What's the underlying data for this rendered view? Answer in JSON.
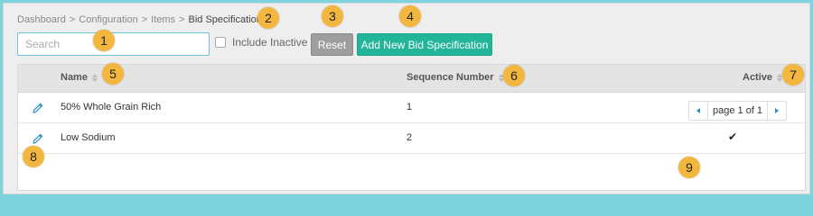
{
  "breadcrumb": {
    "items": [
      "Dashboard",
      "Configuration",
      "Items",
      "Bid Specifications"
    ],
    "separator": ">"
  },
  "search": {
    "placeholder": "Search",
    "value": ""
  },
  "include_inactive": {
    "label": "Include Inactive",
    "checked": false
  },
  "buttons": {
    "reset": "Reset",
    "add": "Add New Bid Specification"
  },
  "table": {
    "columns": [
      "Name",
      "Sequence Number",
      "Active"
    ],
    "rows": [
      {
        "name": "50% Whole Grain Rich",
        "sequence": "1",
        "active": "✔"
      },
      {
        "name": "Low Sodium",
        "sequence": "2",
        "active": "✔"
      }
    ]
  },
  "pagination": {
    "text": "page 1 of 1"
  },
  "callouts": [
    "1",
    "2",
    "3",
    "4",
    "5",
    "6",
    "7",
    "8",
    "9"
  ],
  "colors": {
    "accent": "#22b59a",
    "reset_button": "#9e9e9e",
    "callout_badge": "#f3b740",
    "search_border": "#6fc5d6",
    "background": "#7fd3df"
  }
}
